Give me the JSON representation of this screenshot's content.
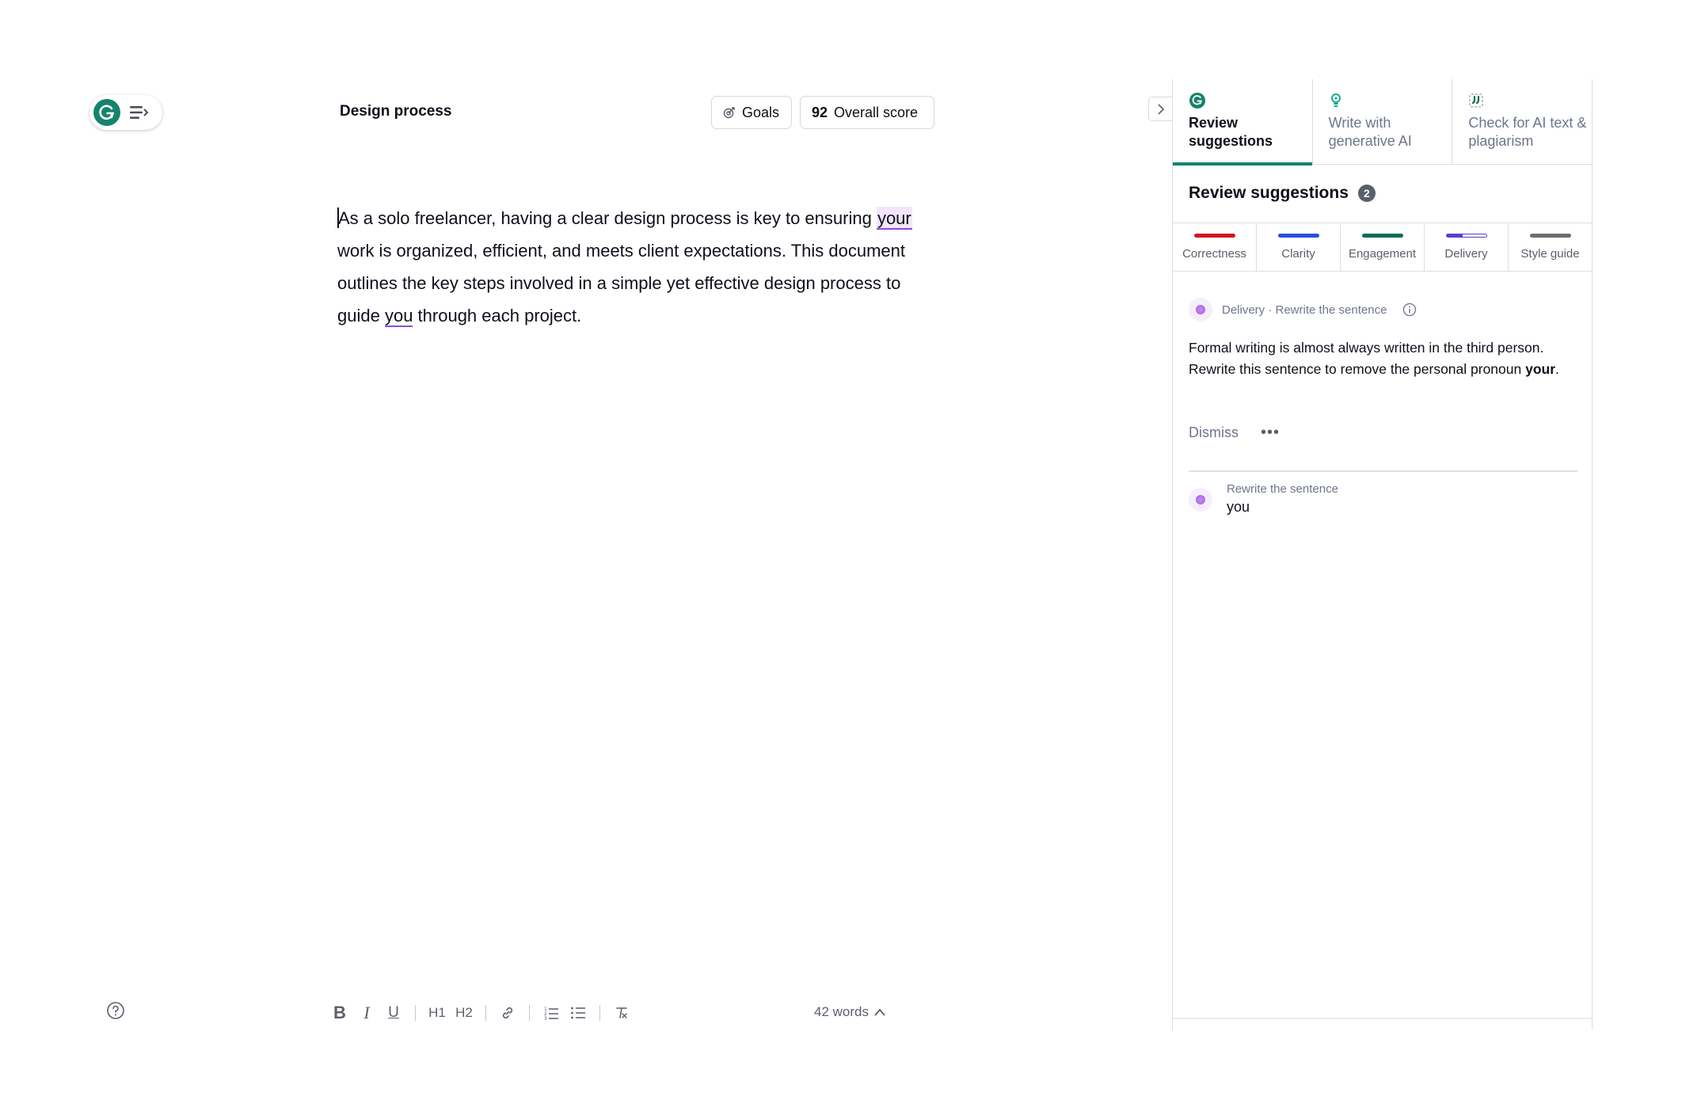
{
  "document": {
    "title": "Design process",
    "body_before_flag1": "As a solo freelancer, having a clear design process is key to ensuring ",
    "flag1": "your",
    "body_middle": " work is organized, efficient, and meets client expectations. This document outlines the key steps involved in a simple yet effective design process to guide ",
    "flag2": "you",
    "body_after": " through each project."
  },
  "header": {
    "goals_label": "Goals",
    "score_value": "92",
    "score_label": "Overall score"
  },
  "toolbar": {
    "bold": "B",
    "italic": "I",
    "underline": "U",
    "h1": "H1",
    "h2": "H2",
    "word_count": "42 words"
  },
  "panel": {
    "tabs": [
      {
        "label": "Review suggestions",
        "icon": "grammarly-g-icon",
        "active": true
      },
      {
        "label": "Write with generative AI",
        "icon": "lightbulb-icon",
        "active": false
      },
      {
        "label": "Check for AI text & plagiarism",
        "icon": "quote-icon",
        "active": false
      }
    ],
    "review_title": "Review suggestions",
    "review_count": "2",
    "categories": [
      {
        "label": "Correctness",
        "color": "#d2151f"
      },
      {
        "label": "Clarity",
        "color": "#2b50d6"
      },
      {
        "label": "Engagement",
        "color": "#0c6b55"
      },
      {
        "label": "Delivery",
        "color": "#5a3fd1"
      },
      {
        "label": "Style guide",
        "color": "#6d6d6d"
      }
    ],
    "card": {
      "meta": "Delivery · Rewrite the sentence",
      "text_before": "Formal writing is almost always written in the third person. Rewrite this sentence to remove the personal pronoun ",
      "text_bold": "your",
      "text_after": ".",
      "dismiss": "Dismiss"
    },
    "item2": {
      "subtitle": "Rewrite the sentence",
      "word": "you"
    }
  },
  "colors": {
    "brand": "#15846c",
    "delivery_flag": "#8a4fd2"
  }
}
